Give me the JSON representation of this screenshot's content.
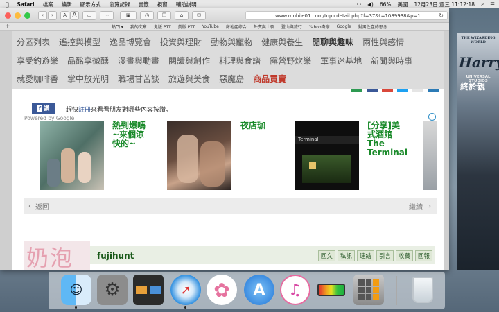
{
  "menubar": {
    "app": "Safari",
    "menus": [
      "檔案",
      "編輯",
      "顯示方式",
      "瀏覽記錄",
      "書籤",
      "視窗",
      "輔助說明"
    ],
    "battery": "66%",
    "input_source": "美國",
    "clock": "12月23日 週三 11:12:18"
  },
  "browser": {
    "url": "www.mobile01.com/topicdetail.php?f=37&t=1089938&p=1",
    "zoom_small": "A",
    "zoom_large": "A",
    "bookmarks": [
      "熱門 ▾",
      "我的文章",
      "鬼版 PTT",
      "美版 PTT",
      "YouTube",
      "房地產綜合",
      "外賓與土夜",
      "登山與旅行",
      "Yahoo奇摩",
      "Google",
      "對男性產的思念"
    ]
  },
  "categories": {
    "row1": [
      "分區列表",
      "遙控與模型",
      "逸品博覽會",
      "投資與理財",
      "動物與寵物",
      "健康與養生",
      "閒聊與趣味",
      "兩性與感情"
    ],
    "row2": [
      "享受釣遊樂",
      "品酩享微醺",
      "漫畫與動畫",
      "閱讀與創作",
      "料理與食譜",
      "露營野炊樂",
      "軍事迷基地",
      "新聞與時事"
    ],
    "row3": [
      "就愛咖啡香",
      "掌中放光明",
      "職場甘苦談",
      "旅遊與美食",
      "惡魔島",
      "商品買賣"
    ]
  },
  "facebook": {
    "button": "讚",
    "prefix": "趕快",
    "link": "註冊",
    "suffix": "來看看朋友對哪些內容按讚。"
  },
  "ads": {
    "powered_by": "Powered by Google",
    "info": "i",
    "cards": [
      {
        "title": "熱到爆嗎\n~來個涼\n快的~"
      },
      {
        "title": "夜店珈"
      },
      {
        "title": "[分享]美\n式酒館\nThe\nTerminal"
      }
    ]
  },
  "pager": {
    "prev": "返回",
    "next": "繼續"
  },
  "post": {
    "avatar_text": "奶泡",
    "username": "fujihunt",
    "actions": [
      "回文",
      "私訊",
      "連結",
      "引言",
      "收藏",
      "回報"
    ]
  },
  "side_ad": {
    "line1": "THE WIZARDING WORLD",
    "line2": "Harry",
    "line3": "UNIVERSAL STUDIOS",
    "line4": "終於親"
  },
  "dock": [
    "Finder",
    "System Preferences",
    "Mission Control",
    "Safari",
    "Photos",
    "App Store",
    "iTunes",
    "Battery Monitor",
    "Calculator",
    "Trash"
  ]
}
